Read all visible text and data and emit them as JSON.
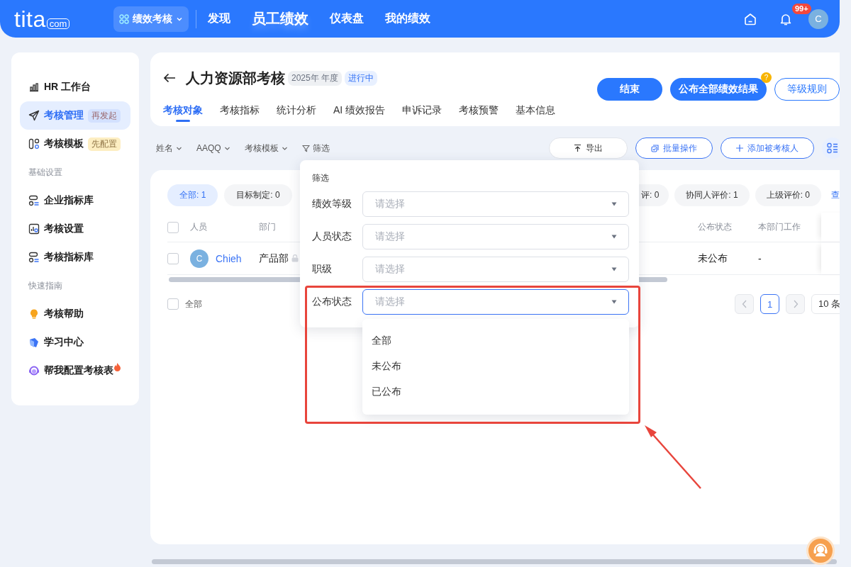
{
  "header": {
    "logo": "tita",
    "logo_suffix": "com",
    "app_switcher": "绩效考核",
    "nav": [
      {
        "label": "发现",
        "selected": false
      },
      {
        "label": "员工绩效",
        "selected": true
      },
      {
        "label": "仪表盘",
        "selected": false
      },
      {
        "label": "我的绩效",
        "selected": false
      }
    ],
    "notification_badge": "99+",
    "avatar": "C"
  },
  "sidebar": {
    "items": [
      {
        "kind": "item",
        "label": "HR 工作台",
        "selected": false,
        "hot": false
      },
      {
        "kind": "item",
        "label": "考核管理",
        "selected": true,
        "hot": false,
        "tag": {
          "text": "再发起",
          "color": "#d3e1ff"
        }
      },
      {
        "kind": "item",
        "label": "考核模板",
        "selected": false,
        "hot": false,
        "tag": {
          "text": "先配置",
          "color": "#fdeec2"
        }
      },
      {
        "kind": "section",
        "label": "基础设置"
      },
      {
        "kind": "item",
        "label": "企业指标库",
        "selected": false,
        "hot": false
      },
      {
        "kind": "item",
        "label": "考核设置",
        "selected": false,
        "hot": false
      },
      {
        "kind": "item",
        "label": "考核指标库",
        "selected": false,
        "hot": false
      },
      {
        "kind": "section",
        "label": "快速指南"
      },
      {
        "kind": "item",
        "label": "考核帮助",
        "selected": false,
        "hot": false
      },
      {
        "kind": "item",
        "label": "学习中心",
        "selected": false,
        "hot": false
      },
      {
        "kind": "item",
        "label": "帮我配置考核表",
        "selected": false,
        "hot": true
      }
    ]
  },
  "page": {
    "title": "人力资源部考核",
    "period_tag": "2025年 年度",
    "status_tag": "进行中",
    "buttons": [
      {
        "label": "结束",
        "kind": "primary"
      },
      {
        "label": "公布全部绩效结果",
        "kind": "primary",
        "help": "?"
      },
      {
        "label": "等级规则",
        "kind": "outline"
      }
    ],
    "tabs": [
      {
        "label": "考核对象",
        "selected": true
      },
      {
        "label": "考核指标",
        "selected": false
      },
      {
        "label": "统计分析",
        "selected": false
      },
      {
        "label": "AI 绩效报告",
        "selected": false
      },
      {
        "label": "申诉记录",
        "selected": false
      },
      {
        "label": "考核预警",
        "selected": false
      },
      {
        "label": "基本信息",
        "selected": false
      }
    ]
  },
  "toolbar": {
    "filters": [
      {
        "label": "姓名",
        "kind": "dropdown"
      },
      {
        "label": "AAQQ",
        "kind": "dropdown"
      },
      {
        "label": "考核模板",
        "kind": "dropdown"
      },
      {
        "label": "筛选",
        "kind": "filter"
      }
    ],
    "actions": [
      {
        "label": "导出",
        "kind": "export"
      },
      {
        "label": "批量操作",
        "kind": "batch"
      },
      {
        "label": "添加被考核人",
        "kind": "add"
      },
      {
        "kind": "view"
      }
    ]
  },
  "table": {
    "chips_left": [
      {
        "label": "全部: 1",
        "selected": true
      },
      {
        "label": "目标制定: 0",
        "selected": false
      }
    ],
    "chips_right": [
      {
        "label": "评: 0",
        "selected": false
      },
      {
        "label": "协同人评价: 1",
        "selected": false
      },
      {
        "label": "上级评价: 0",
        "selected": false
      }
    ],
    "more_link": "查",
    "header_checked": false,
    "columns": [
      "人员",
      "部门",
      "公布状态",
      "本部门工作"
    ],
    "rows": [
      {
        "checked": false,
        "avatar": "C",
        "name": "Chieh",
        "department": "产品部",
        "locked": true,
        "publish_status": "未公布",
        "dept_work": "-"
      }
    ],
    "select_all": {
      "label": "全部",
      "checked": false
    },
    "pagination": {
      "pages": [
        {
          "label": "1",
          "selected": true
        }
      ],
      "page_size": "10 条"
    }
  },
  "filter_popup": {
    "title": "筛选",
    "fields": [
      {
        "label": "绩效等级",
        "placeholder": "请选择",
        "focused": false
      },
      {
        "label": "人员状态",
        "placeholder": "请选择",
        "focused": false
      },
      {
        "label": "职级",
        "placeholder": "请选择",
        "focused": false
      },
      {
        "label": "公布状态",
        "placeholder": "请选择",
        "focused": true
      }
    ],
    "options": [
      {
        "label": "全部",
        "selected": false
      },
      {
        "label": "未公布",
        "selected": false
      },
      {
        "label": "已公布",
        "selected": false
      }
    ]
  },
  "annotation": {
    "kind": "box_with_arrow"
  }
}
